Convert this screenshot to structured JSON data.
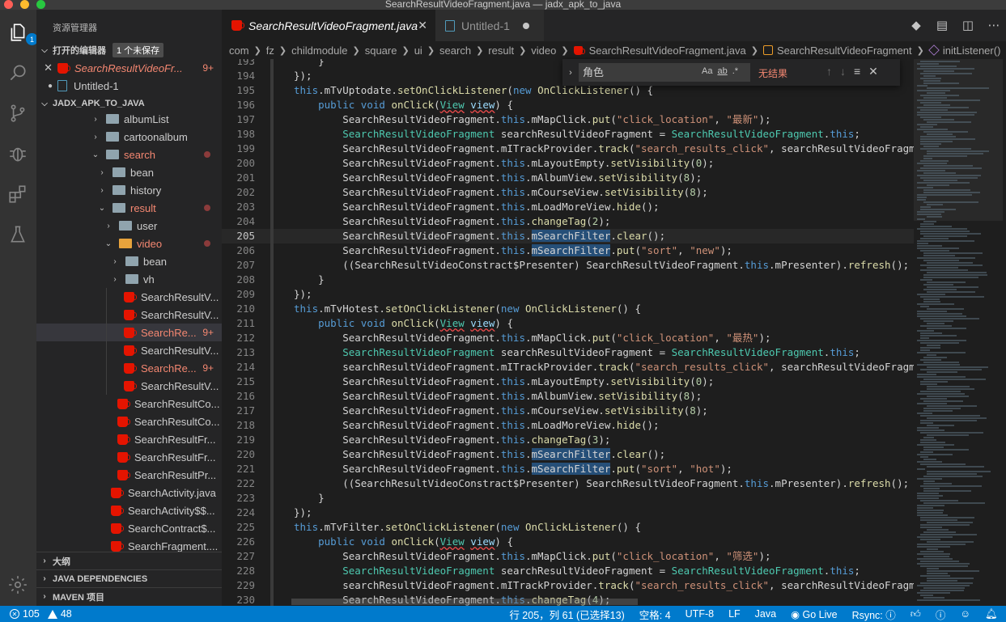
{
  "window": {
    "title": "SearchResultVideoFragment.java — jadx_apk_to_java"
  },
  "activity": {
    "explorer_badge": "1"
  },
  "sidebar": {
    "title": "资源管理器",
    "open_editors": {
      "label": "打开的编辑器",
      "badge": "1 个未保存"
    },
    "open_files": [
      {
        "name": "SearchResultVideoFr...",
        "count": "9+"
      },
      {
        "name": "Untitled-1"
      }
    ],
    "project": "JADX_APK_TO_JAVA",
    "tree": [
      {
        "label": "albumList"
      },
      {
        "label": "cartoonalbum"
      },
      {
        "label": "search"
      },
      {
        "label": "bean"
      },
      {
        "label": "history"
      },
      {
        "label": "result"
      },
      {
        "label": "user"
      },
      {
        "label": "video"
      },
      {
        "label": "bean"
      },
      {
        "label": "vh"
      },
      {
        "label": "SearchResultV..."
      },
      {
        "label": "SearchResultV..."
      },
      {
        "label": "SearchRe...",
        "count": "9+"
      },
      {
        "label": "SearchResultV..."
      },
      {
        "label": "SearchRe...",
        "count": "9+"
      },
      {
        "label": "SearchResultV..."
      },
      {
        "label": "SearchResultCo..."
      },
      {
        "label": "SearchResultCo..."
      },
      {
        "label": "SearchResultFr..."
      },
      {
        "label": "SearchResultFr..."
      },
      {
        "label": "SearchResultPr..."
      },
      {
        "label": "SearchActivity.java"
      },
      {
        "label": "SearchActivity$$..."
      },
      {
        "label": "SearchContract$..."
      },
      {
        "label": "SearchFragment...."
      }
    ],
    "outline": "大纲",
    "java_deps": "JAVA DEPENDENCIES",
    "maven": "MAVEN 项目"
  },
  "tabs": [
    {
      "label": "SearchResultVideoFragment.java"
    },
    {
      "label": "Untitled-1"
    }
  ],
  "breadcrumb": [
    "com",
    "fz",
    "childmodule",
    "square",
    "ui",
    "search",
    "result",
    "video",
    "SearchResultVideoFragment.java",
    "SearchResultVideoFragment",
    "initListener()"
  ],
  "find": {
    "value": "角色",
    "result": "无结果"
  },
  "lines": [
    {
      "n": "193",
      "code": "    }"
    },
    {
      "n": "194",
      "code": "});"
    },
    {
      "n": "195",
      "code": "this.mTvUptodate.setOnClickListener(new OnClickListener() {"
    },
    {
      "n": "196",
      "code": "    public void onClick(View view) {"
    },
    {
      "n": "197",
      "code": "        SearchResultVideoFragment.this.mMapClick.put(\"click_location\", \"最新\");"
    },
    {
      "n": "198",
      "code": "        SearchResultVideoFragment searchResultVideoFragment = SearchResultVideoFragment.this;"
    },
    {
      "n": "199",
      "code": "        SearchResultVideoFragment.mITrackProvider.track(\"search_results_click\", searchResultVideoFragment."
    },
    {
      "n": "200",
      "code": "        SearchResultVideoFragment.this.mLayoutEmpty.setVisibility(0);"
    },
    {
      "n": "201",
      "code": "        SearchResultVideoFragment.this.mAlbumView.setVisibility(8);"
    },
    {
      "n": "202",
      "code": "        SearchResultVideoFragment.this.mCourseView.setVisibility(8);"
    },
    {
      "n": "203",
      "code": "        SearchResultVideoFragment.this.mLoadMoreView.hide();"
    },
    {
      "n": "204",
      "code": "        SearchResultVideoFragment.this.changeTag(2);"
    },
    {
      "n": "205",
      "code": "        SearchResultVideoFragment.this.mSearchFilter.clear();"
    },
    {
      "n": "206",
      "code": "        SearchResultVideoFragment.this.mSearchFilter.put(\"sort\", \"new\");"
    },
    {
      "n": "207",
      "code": "        ((SearchResultVideoConstract$Presenter) SearchResultVideoFragment.this.mPresenter).refresh();"
    },
    {
      "n": "208",
      "code": "    }"
    },
    {
      "n": "209",
      "code": "});"
    },
    {
      "n": "210",
      "code": "this.mTvHotest.setOnClickListener(new OnClickListener() {"
    },
    {
      "n": "211",
      "code": "    public void onClick(View view) {"
    },
    {
      "n": "212",
      "code": "        SearchResultVideoFragment.this.mMapClick.put(\"click_location\", \"最热\");"
    },
    {
      "n": "213",
      "code": "        SearchResultVideoFragment searchResultVideoFragment = SearchResultVideoFragment.this;"
    },
    {
      "n": "214",
      "code": "        searchResultVideoFragment.mITrackProvider.track(\"search_results_click\", searchResultVideoFragment."
    },
    {
      "n": "215",
      "code": "        SearchResultVideoFragment.this.mLayoutEmpty.setVisibility(0);"
    },
    {
      "n": "216",
      "code": "        SearchResultVideoFragment.this.mAlbumView.setVisibility(8);"
    },
    {
      "n": "217",
      "code": "        SearchResultVideoFragment.this.mCourseView.setVisibility(8);"
    },
    {
      "n": "218",
      "code": "        SearchResultVideoFragment.this.mLoadMoreView.hide();"
    },
    {
      "n": "219",
      "code": "        SearchResultVideoFragment.this.changeTag(3);"
    },
    {
      "n": "220",
      "code": "        SearchResultVideoFragment.this.mSearchFilter.clear();"
    },
    {
      "n": "221",
      "code": "        SearchResultVideoFragment.this.mSearchFilter.put(\"sort\", \"hot\");"
    },
    {
      "n": "222",
      "code": "        ((SearchResultVideoConstract$Presenter) SearchResultVideoFragment.this.mPresenter).refresh();"
    },
    {
      "n": "223",
      "code": "    }"
    },
    {
      "n": "224",
      "code": "});"
    },
    {
      "n": "225",
      "code": "this.mTvFilter.setOnClickListener(new OnClickListener() {"
    },
    {
      "n": "226",
      "code": "    public void onClick(View view) {"
    },
    {
      "n": "227",
      "code": "        SearchResultVideoFragment.this.mMapClick.put(\"click_location\", \"筛选\");"
    },
    {
      "n": "228",
      "code": "        SearchResultVideoFragment searchResultVideoFragment = SearchResultVideoFragment.this;"
    },
    {
      "n": "229",
      "code": "        searchResultVideoFragment.mITrackProvider.track(\"search_results_click\", searchResultVideoFragment."
    },
    {
      "n": "230",
      "code": "        SearchResultVideoFragment.this.changeTag(4);"
    }
  ],
  "current_line": "205",
  "status": {
    "errors": "105",
    "warnings": "48",
    "cursor": "行 205，列 61 (已选择13)",
    "spaces": "空格: 4",
    "encoding": "UTF-8",
    "eol": "LF",
    "language": "Java",
    "golive": "Go Live",
    "rsync": "Rsync:"
  },
  "colors": {
    "accent": "#007acc",
    "error": "#f48771",
    "java": "#e51400"
  }
}
